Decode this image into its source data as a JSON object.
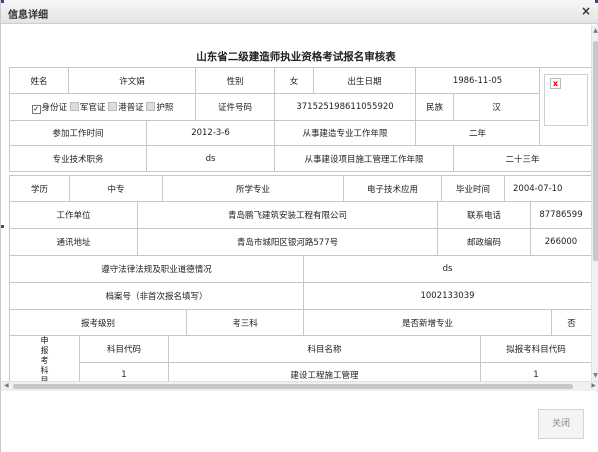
{
  "dialog": {
    "title": "信息详细",
    "close_symbol": "×"
  },
  "form": {
    "title": "山东省二级建造师执业资格考试报名审核表",
    "row1": {
      "name_label": "姓名",
      "name_value": "许文娟",
      "gender_label": "性别",
      "gender_value": "女",
      "birth_label": "出生日期",
      "birth_value": "1986-11-05"
    },
    "photo": {
      "broken_icon": "x"
    },
    "row2": {
      "id_types": [
        {
          "label": "身份证",
          "checked": true
        },
        {
          "label": "军官证",
          "checked": false
        },
        {
          "label": "港普证",
          "checked": false
        },
        {
          "label": "护照",
          "checked": false
        }
      ],
      "cert_label": "证件号码",
      "cert_value": "371525198611055920",
      "ethnic_label": "民族",
      "ethnic_value": "汉"
    },
    "row3": {
      "work_start_label": "参加工作时间",
      "work_start_value": "2012-3-6",
      "years_label": "从事建造专业工作年限",
      "years_value": "二年"
    },
    "row4": {
      "title_label": "专业技术职务",
      "title_value": "ds",
      "mgmt_label": "从事建设项目施工管理工作年限",
      "mgmt_value": "二十三年"
    },
    "row5": {
      "edu_label": "学历",
      "edu_value": "中专",
      "major_label": "所学专业",
      "major_value": "电子技术应用",
      "grad_label": "毕业时间",
      "grad_value": "2004-07-10"
    },
    "row6": {
      "employer_label": "工作单位",
      "employer_value": "青岛鹏飞建筑安装工程有限公司",
      "phone_label": "联系电话",
      "phone_value": "87786599"
    },
    "row7": {
      "address_label": "通讯地址",
      "address_value": "青岛市城阳区银河路577号",
      "zip_label": "邮政编码",
      "zip_value": "266000"
    },
    "row8": {
      "law_label": "遵守法律法规及职业道德情况",
      "law_value": "ds"
    },
    "row9": {
      "file_label": "档案号（非首次报名填写）",
      "file_value": "1002133039"
    },
    "row10": {
      "level_label": "报考级别",
      "level_value": "考三科",
      "newmajor_label": "是否新增专业",
      "newmajor_value": "否"
    },
    "subjects": {
      "side_label": "申报考科目",
      "headers": [
        "科目代码",
        "科目名称",
        "拟报考科目代码"
      ],
      "rows": [
        {
          "code": "1",
          "name": "建设工程施工管理",
          "plan": "1"
        }
      ]
    }
  },
  "footer": {
    "close_label": "关闭"
  }
}
